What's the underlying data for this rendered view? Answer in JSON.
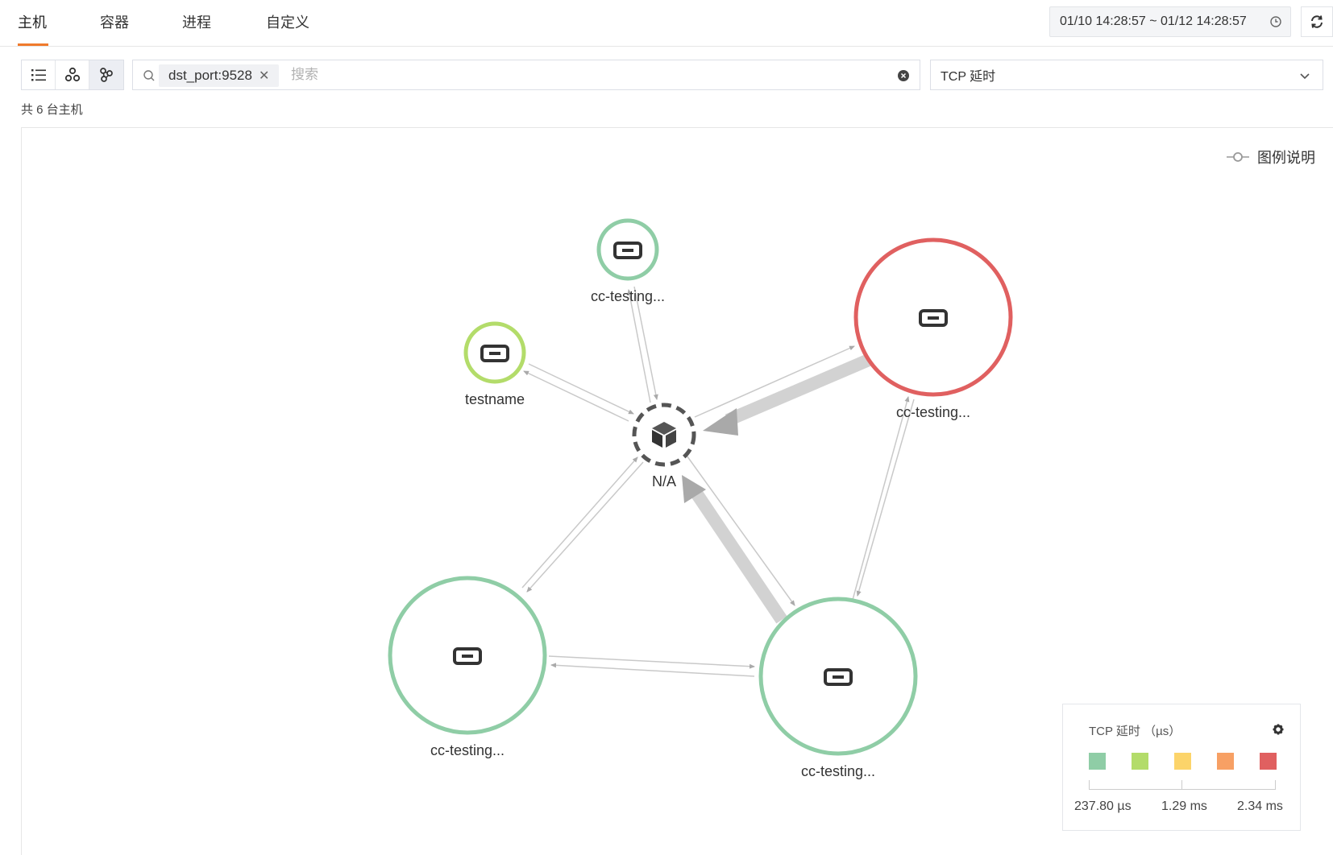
{
  "tabs": [
    {
      "label": "主机"
    },
    {
      "label": "容器"
    },
    {
      "label": "进程"
    },
    {
      "label": "自定义"
    }
  ],
  "time_range": "01/10 14:28:57 ~ 01/12 14:28:57",
  "filter": {
    "tag": "dst_port:9528",
    "placeholder": "搜索"
  },
  "metric_select": "TCP 延时",
  "host_count": "共 6 台主机",
  "legend_toggle": "图例说明",
  "graph": {
    "center_label": "N/A",
    "nodes": [
      {
        "label": "cc-testing...",
        "color": "#8fcda6"
      },
      {
        "label": "testname",
        "color": "#b3dc6a"
      },
      {
        "label": "cc-testing...",
        "color": "#e06060"
      },
      {
        "label": "cc-testing...",
        "color": "#8fcda6"
      },
      {
        "label": "cc-testing...",
        "color": "#8fcda6"
      }
    ]
  },
  "legend": {
    "title": "TCP 延时 （µs）",
    "colors": [
      "#8fcda6",
      "#b3dc6a",
      "#fcd46a",
      "#f7a064",
      "#e06060"
    ],
    "labels": [
      "237.80 µs",
      "1.29 ms",
      "2.34 ms"
    ]
  }
}
